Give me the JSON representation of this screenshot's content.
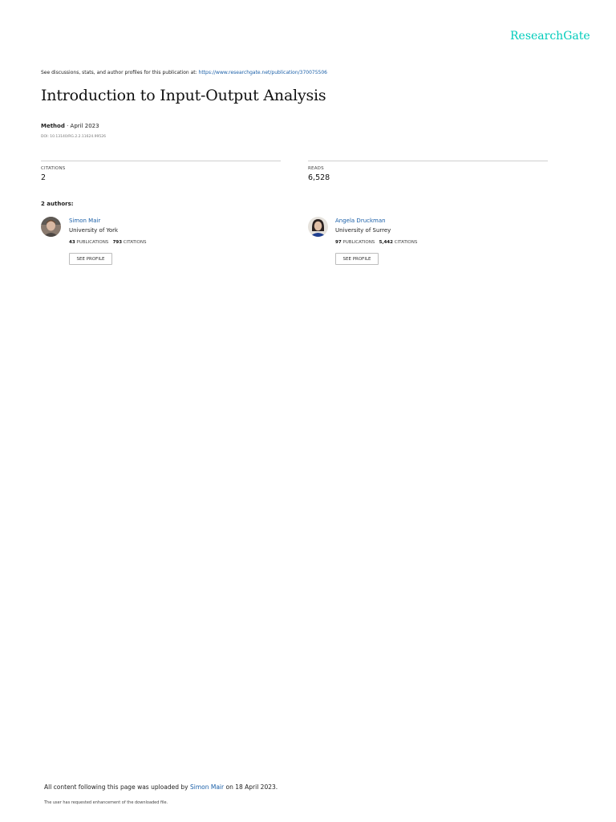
{
  "header": {
    "logo": "ResearchGate"
  },
  "intro": {
    "text": "See discussions, stats, and author profiles for this publication at: ",
    "link": "https://www.researchgate.net/publication/370075506"
  },
  "publication": {
    "title": "Introduction to Input-Output Analysis",
    "type": "Method",
    "date": " · April 2023",
    "doi": "DOI: 10.13140/RG.2.2.11624.99526"
  },
  "stats": {
    "citations_label": "CITATIONS",
    "citations_value": "2",
    "reads_label": "READS",
    "reads_value": "6,528"
  },
  "authors": {
    "heading": "2 authors:",
    "list": [
      {
        "name": "Simon Mair",
        "institution": "University of York",
        "publications": "43",
        "publications_label": "PUBLICATIONS",
        "citations": "793",
        "citations_label": "CITATIONS",
        "button": "SEE PROFILE"
      },
      {
        "name": "Angela Druckman",
        "institution": "University of Surrey",
        "publications": "97",
        "publications_label": "PUBLICATIONS",
        "citations": "5,442",
        "citations_label": "CITATIONS",
        "button": "SEE PROFILE"
      }
    ]
  },
  "footer": {
    "uploaded_prefix": "All content following this page was uploaded by ",
    "uploader": "Simon Mair",
    "uploaded_suffix": " on 18 April 2023.",
    "note": "The user has requested enhancement of the downloaded file."
  },
  "colors": {
    "brand": "#00ccbb",
    "link": "#1a5fa8"
  }
}
